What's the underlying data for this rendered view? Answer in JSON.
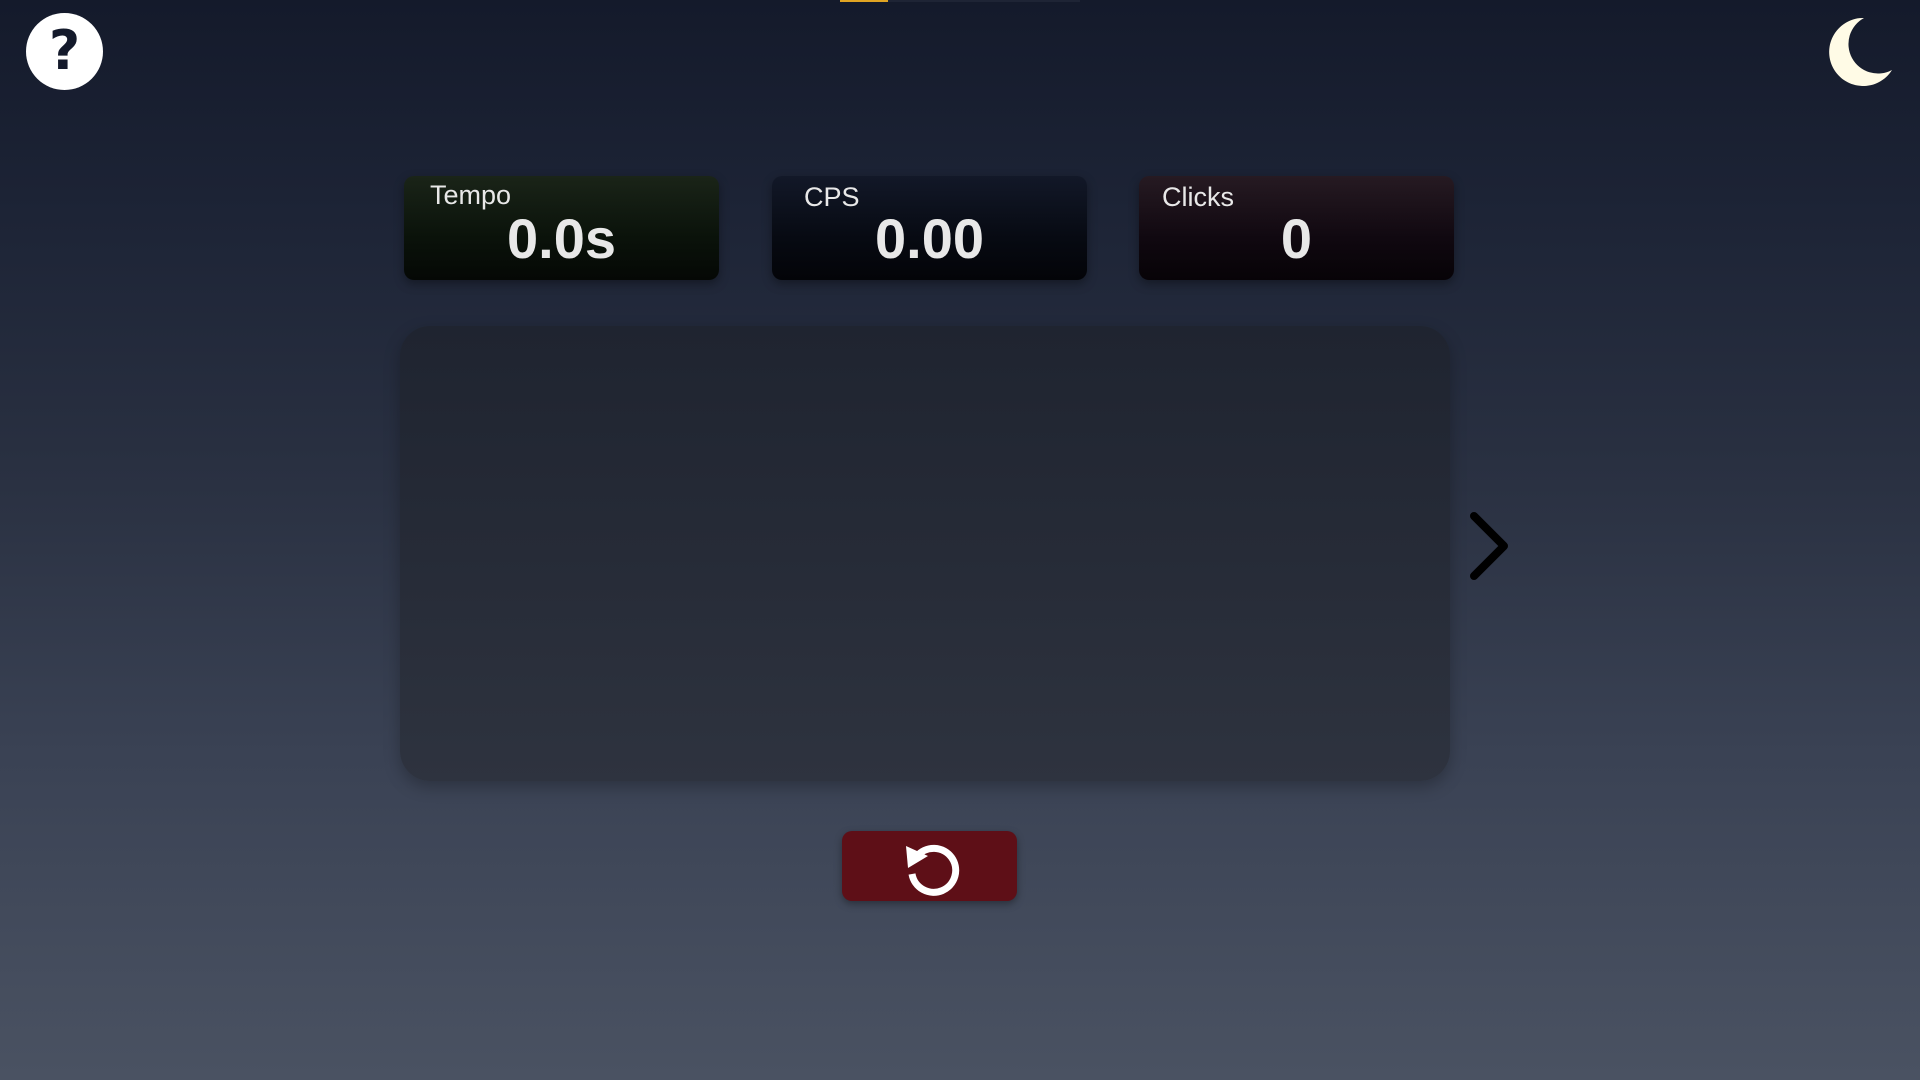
{
  "progress": {
    "fraction": 0.2,
    "accent_color": "#e0a423"
  },
  "help": {
    "icon": "question-mark-icon",
    "glyph": "?"
  },
  "theme_toggle": {
    "icon": "moon-icon",
    "color": "#fffbe6"
  },
  "stats": {
    "time": {
      "label": "Tempo",
      "value": "0.0s"
    },
    "cps": {
      "label": "CPS",
      "value": "0.00"
    },
    "clicks": {
      "label": "Clicks",
      "value": "0"
    }
  },
  "click_area": {
    "text": ""
  },
  "next": {
    "icon": "chevron-right-icon"
  },
  "reset": {
    "icon": "restart-icon",
    "color": "#5e0f17"
  }
}
